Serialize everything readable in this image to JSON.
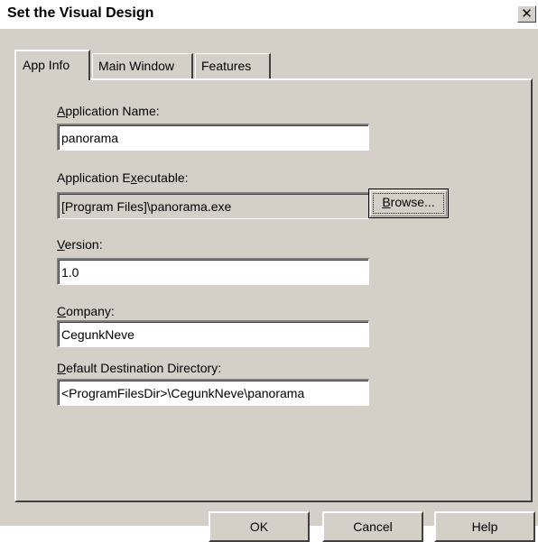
{
  "window": {
    "title": "Set the Visual Design",
    "close_glyph": "✕"
  },
  "tabs": [
    {
      "label": "App Info",
      "active": true
    },
    {
      "label": "Main Window",
      "active": false
    },
    {
      "label": "Features",
      "active": false
    }
  ],
  "form": {
    "app_name": {
      "label_accel": "A",
      "label_rest": "pplication Name:",
      "value": "panorama"
    },
    "app_exe": {
      "label_pre": "Application E",
      "label_accel": "x",
      "label_rest": "ecutable:",
      "value": "[Program Files]\\panorama.exe"
    },
    "version": {
      "label_accel": "V",
      "label_rest": "ersion:",
      "value": "1.0"
    },
    "company": {
      "label_accel": "C",
      "label_rest": "ompany:",
      "value": "CegunkNeve"
    },
    "dest_dir": {
      "label_accel": "D",
      "label_rest": "efault Destination Directory:",
      "value": "<ProgramFilesDir>\\CegunkNeve\\panorama"
    },
    "browse": {
      "label_accel": "B",
      "label_rest": "rowse..."
    }
  },
  "buttons": {
    "ok": "OK",
    "cancel": "Cancel",
    "help": "Help"
  }
}
